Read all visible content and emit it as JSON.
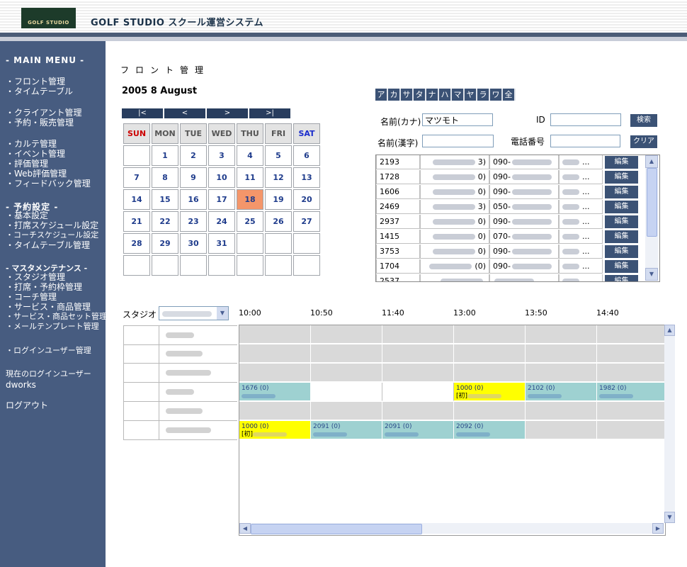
{
  "header": {
    "logo_text": "GOLF STUDIO",
    "title": "GOLF STUDIO スクール運営システム"
  },
  "sidebar": {
    "main_menu": "- MAIN MENU -",
    "group1": [
      "・フロント管理",
      "・タイムテーブル"
    ],
    "group2": [
      "・クライアント管理",
      "・予約・販売管理"
    ],
    "group3": [
      "・カルテ管理",
      "・イベント管理",
      "・評価管理",
      "・Web評価管理",
      "・フィードバック管理"
    ],
    "reserve_head": "- 予約設定 -",
    "group4": [
      "・基本設定",
      "・打席スケジュール設定",
      "・コーチスケジュール設定",
      "・タイムテーブル管理"
    ],
    "master_head": "- マスタメンテナンス -",
    "group5": [
      "・スタジオ管理",
      "・打席・予約枠管理",
      "・コーチ管理",
      "・サービス・商品管理",
      "・サービス・商品セット管理",
      "・メールテンプレート管理"
    ],
    "login_user_admin": "・ログインユーザー管理",
    "current_user_label": "現在のログインユーザー",
    "current_user": "dworks",
    "logout": "ログアウト"
  },
  "main": {
    "page_title": "フロント管理",
    "date_title": "2005  8  August"
  },
  "cal_nav": [
    "|<",
    "<",
    ">",
    ">|"
  ],
  "calendar": {
    "weekdays": [
      "SUN",
      "MON",
      "TUE",
      "WED",
      "THU",
      "FRI",
      "SAT"
    ],
    "weeks": [
      [
        "",
        "1",
        "2",
        "3",
        "4",
        "5",
        "6"
      ],
      [
        "7",
        "8",
        "9",
        "10",
        "11",
        "12",
        "13"
      ],
      [
        "14",
        "15",
        "16",
        "17",
        "18",
        "19",
        "20"
      ],
      [
        "21",
        "22",
        "23",
        "24",
        "25",
        "26",
        "27"
      ],
      [
        "28",
        "29",
        "30",
        "31",
        "",
        "",
        ""
      ],
      [
        "",
        "",
        "",
        "",
        "",
        "",
        ""
      ]
    ],
    "today": "18",
    "colors": {
      "sun": "#cc0000",
      "sat": "#1a2ccc",
      "today_bg": "#f4966a"
    }
  },
  "kana_buttons": [
    "ア",
    "カ",
    "サ",
    "タ",
    "ナ",
    "ハ",
    "マ",
    "ヤ",
    "ラ",
    "ワ",
    "全"
  ],
  "search": {
    "kana_label": "名前(カナ)",
    "kana_value": "マツモト",
    "id_label": "ID",
    "id_value": "",
    "kanji_label": "名前(漢字)",
    "kanji_value": "",
    "phone_label": "電話番号",
    "phone_value": "",
    "search_btn": "検索",
    "clear_btn": "クリア"
  },
  "results": {
    "edit_label": "編集",
    "rows": [
      {
        "id": "2193",
        "tail": "3)",
        "phone": "090-"
      },
      {
        "id": "1728",
        "tail": "0)",
        "phone": "090-"
      },
      {
        "id": "1606",
        "tail": "0)",
        "phone": "090-"
      },
      {
        "id": "2469",
        "tail": "3)",
        "phone": "050-"
      },
      {
        "id": "2937",
        "tail": "0)",
        "phone": "090-"
      },
      {
        "id": "1415",
        "tail": "0)",
        "phone": "070-"
      },
      {
        "id": "3753",
        "tail": "0)",
        "phone": "090-"
      },
      {
        "id": "1704",
        "tail": "(0)",
        "phone": "090-"
      },
      {
        "id": "2537",
        "tail": "",
        "phone": ""
      }
    ],
    "ellipsis": "..."
  },
  "timeline": {
    "studio_label": "スタジオ",
    "times": [
      "10:00",
      "10:50",
      "11:40",
      "13:00",
      "13:50",
      "14:40"
    ],
    "rows": [
      {
        "cells": [
          "grey",
          "grey",
          "grey",
          "grey",
          "grey",
          "grey"
        ]
      },
      {
        "cells": [
          "grey",
          "grey",
          "grey",
          "grey",
          "grey",
          "grey"
        ]
      },
      {
        "cells": [
          "grey",
          "grey",
          "grey",
          "grey",
          "grey",
          "grey"
        ]
      },
      {
        "cells": [
          "teal:1676  (0)",
          "white",
          "white",
          "yellow:1000  (0):[初]",
          "teal:2102  (0)",
          "teal:1982  (0)"
        ]
      },
      {
        "cells": [
          "grey",
          "grey",
          "grey",
          "grey",
          "grey",
          "grey"
        ]
      },
      {
        "cells": [
          "yellow:1000  (0):[初]",
          "teal:2091  (0)",
          "teal:2091  (0)",
          "teal:2092  (0)",
          "grey",
          "grey"
        ]
      }
    ]
  }
}
